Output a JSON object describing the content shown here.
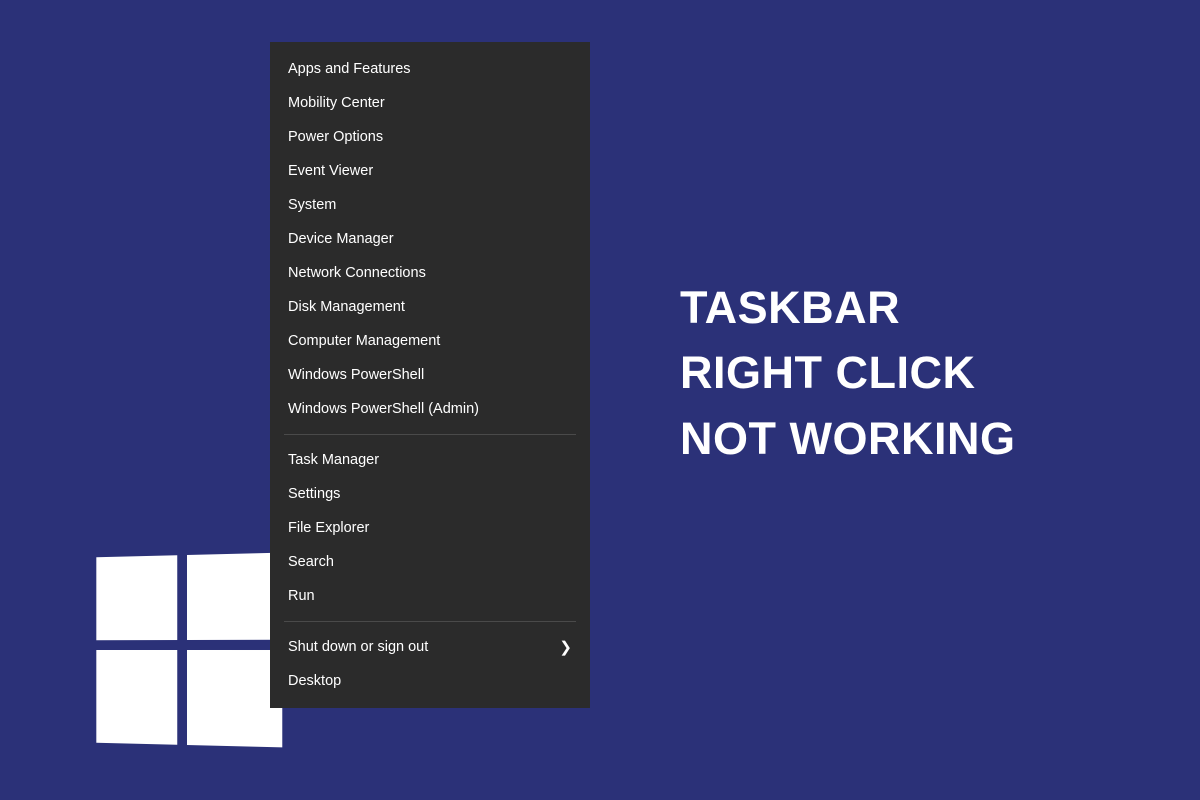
{
  "headline": {
    "line1": "TASKBAR",
    "line2": "RIGHT CLICK",
    "line3": "NOT WORKING"
  },
  "menu": {
    "group1": [
      "Apps and Features",
      "Mobility Center",
      "Power Options",
      "Event Viewer",
      "System",
      "Device Manager",
      "Network Connections",
      "Disk Management",
      "Computer Management",
      "Windows PowerShell",
      "Windows PowerShell (Admin)"
    ],
    "group2": [
      "Task Manager",
      "Settings",
      "File Explorer",
      "Search",
      "Run"
    ],
    "group3": {
      "shutdown": "Shut down or sign out",
      "desktop": "Desktop"
    }
  }
}
